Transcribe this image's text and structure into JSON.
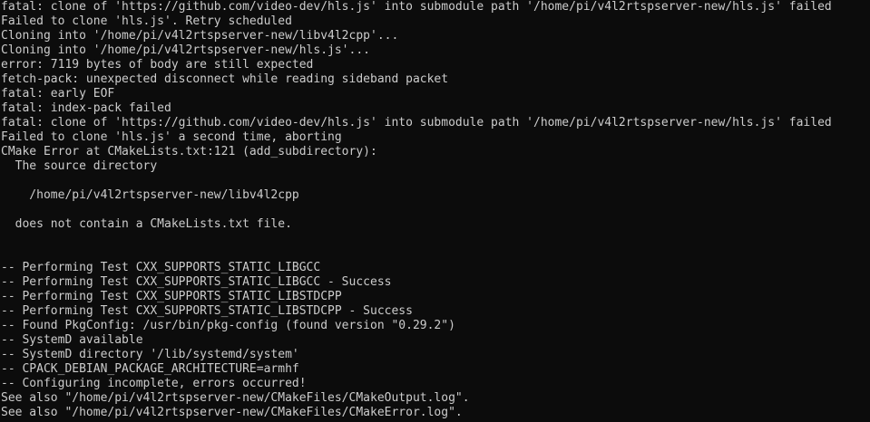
{
  "colors": {
    "background": "#0c0c0c",
    "foreground": "#cccccc"
  },
  "terminal": {
    "lines": [
      "fatal: clone of 'https://github.com/video-dev/hls.js' into submodule path '/home/pi/v4l2rtspserver-new/hls.js' failed",
      "Failed to clone 'hls.js'. Retry scheduled",
      "Cloning into '/home/pi/v4l2rtspserver-new/libv4l2cpp'...",
      "Cloning into '/home/pi/v4l2rtspserver-new/hls.js'...",
      "error: 7119 bytes of body are still expected",
      "fetch-pack: unexpected disconnect while reading sideband packet",
      "fatal: early EOF",
      "fatal: index-pack failed",
      "fatal: clone of 'https://github.com/video-dev/hls.js' into submodule path '/home/pi/v4l2rtspserver-new/hls.js' failed",
      "Failed to clone 'hls.js' a second time, aborting",
      "CMake Error at CMakeLists.txt:121 (add_subdirectory):",
      "  The source directory",
      "",
      "    /home/pi/v4l2rtspserver-new/libv4l2cpp",
      "",
      "  does not contain a CMakeLists.txt file.",
      "",
      "",
      "-- Performing Test CXX_SUPPORTS_STATIC_LIBGCC",
      "-- Performing Test CXX_SUPPORTS_STATIC_LIBGCC - Success",
      "-- Performing Test CXX_SUPPORTS_STATIC_LIBSTDCPP",
      "-- Performing Test CXX_SUPPORTS_STATIC_LIBSTDCPP - Success",
      "-- Found PkgConfig: /usr/bin/pkg-config (found version \"0.29.2\")",
      "-- SystemD available",
      "-- SystemD directory '/lib/systemd/system'",
      "-- CPACK_DEBIAN_PACKAGE_ARCHITECTURE=armhf",
      "-- Configuring incomplete, errors occurred!",
      "See also \"/home/pi/v4l2rtspserver-new/CMakeFiles/CMakeOutput.log\".",
      "See also \"/home/pi/v4l2rtspserver-new/CMakeFiles/CMakeError.log\"."
    ]
  }
}
